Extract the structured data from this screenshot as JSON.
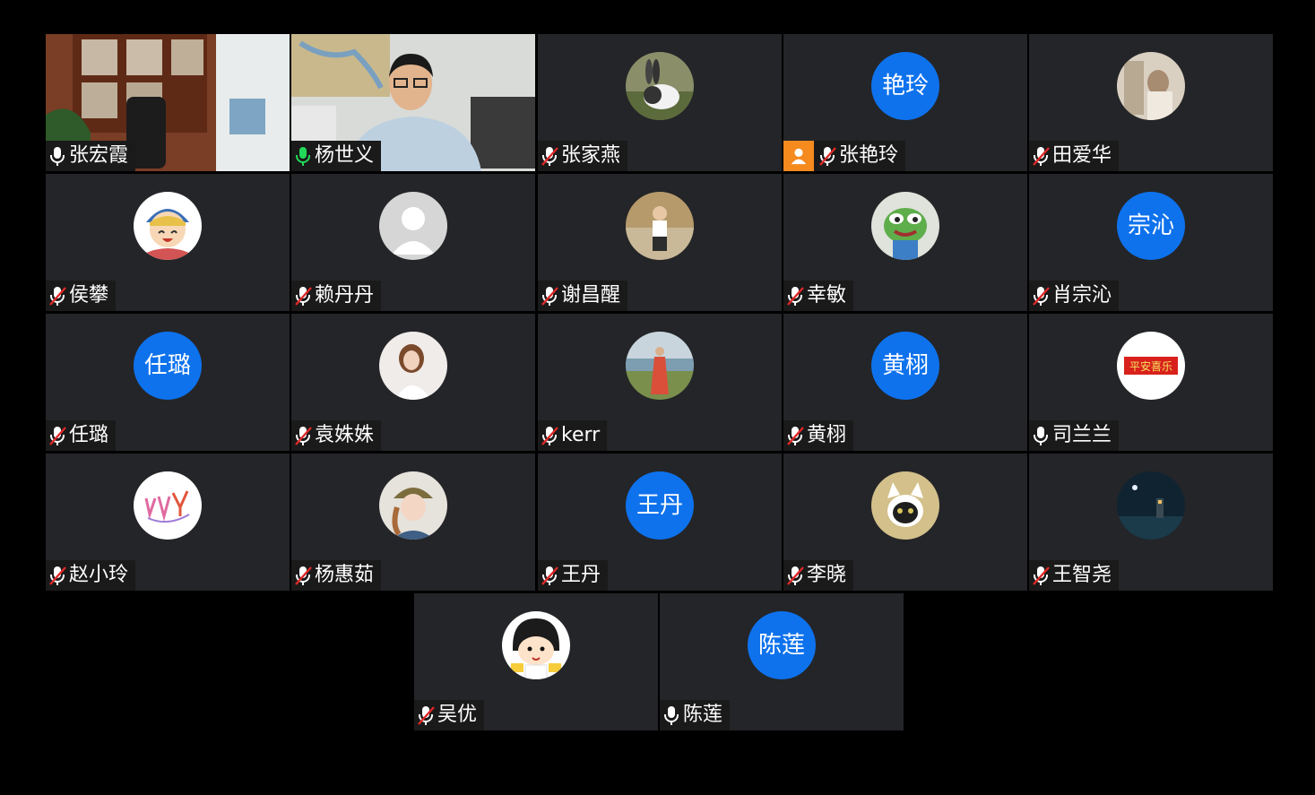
{
  "participants": [
    {
      "name": "张宏霞",
      "mic": "on",
      "tile": "video-office"
    },
    {
      "name": "杨世义",
      "mic": "on-green",
      "tile": "video-man",
      "active": true
    },
    {
      "name": "张家燕",
      "mic": "muted",
      "avatar": "rabbit-photo"
    },
    {
      "name": "张艳玲",
      "mic": "muted",
      "avatar_text": "艳玲",
      "host_badge": true
    },
    {
      "name": "田爱华",
      "mic": "muted",
      "avatar": "photo-light"
    },
    {
      "name": "侯攀",
      "mic": "muted",
      "avatar": "cartoon-boy"
    },
    {
      "name": "赖丹丹",
      "mic": "muted",
      "avatar": "default-silhouette"
    },
    {
      "name": "谢昌醒",
      "mic": "muted",
      "avatar": "person-photo"
    },
    {
      "name": "幸敏",
      "mic": "muted",
      "avatar": "frog-cartoon"
    },
    {
      "name": "肖宗沁",
      "mic": "muted",
      "avatar_text": "宗沁"
    },
    {
      "name": "任璐",
      "mic": "muted",
      "avatar_text": "任璐"
    },
    {
      "name": "袁姝姝",
      "mic": "muted",
      "avatar": "girl-photo"
    },
    {
      "name": "kerr",
      "mic": "muted",
      "avatar": "beach-photo"
    },
    {
      "name": "黄栩",
      "mic": "muted",
      "avatar_text": "黄栩"
    },
    {
      "name": "司兰兰",
      "mic": "on",
      "avatar": "red-banner",
      "avatar_banner": "平安喜乐"
    },
    {
      "name": "赵小玲",
      "mic": "muted",
      "avatar": "doodle"
    },
    {
      "name": "杨惠茹",
      "mic": "muted",
      "avatar": "girl-hat-photo"
    },
    {
      "name": "王丹",
      "mic": "muted",
      "avatar_text": "王丹"
    },
    {
      "name": "李晓",
      "mic": "muted",
      "avatar": "cat-photo"
    },
    {
      "name": "王智尧",
      "mic": "muted",
      "avatar": "night-photo"
    },
    {
      "name": "吴优",
      "mic": "muted",
      "avatar": "maruko-cartoon"
    },
    {
      "name": "陈莲",
      "mic": "on",
      "avatar_text": "陈莲"
    }
  ],
  "colors": {
    "tile_bg": "#242528",
    "avatar_blue": "#0e72ed",
    "active_border": "#23d959",
    "host_badge": "#f58a1f",
    "muted_red": "#e02828"
  }
}
